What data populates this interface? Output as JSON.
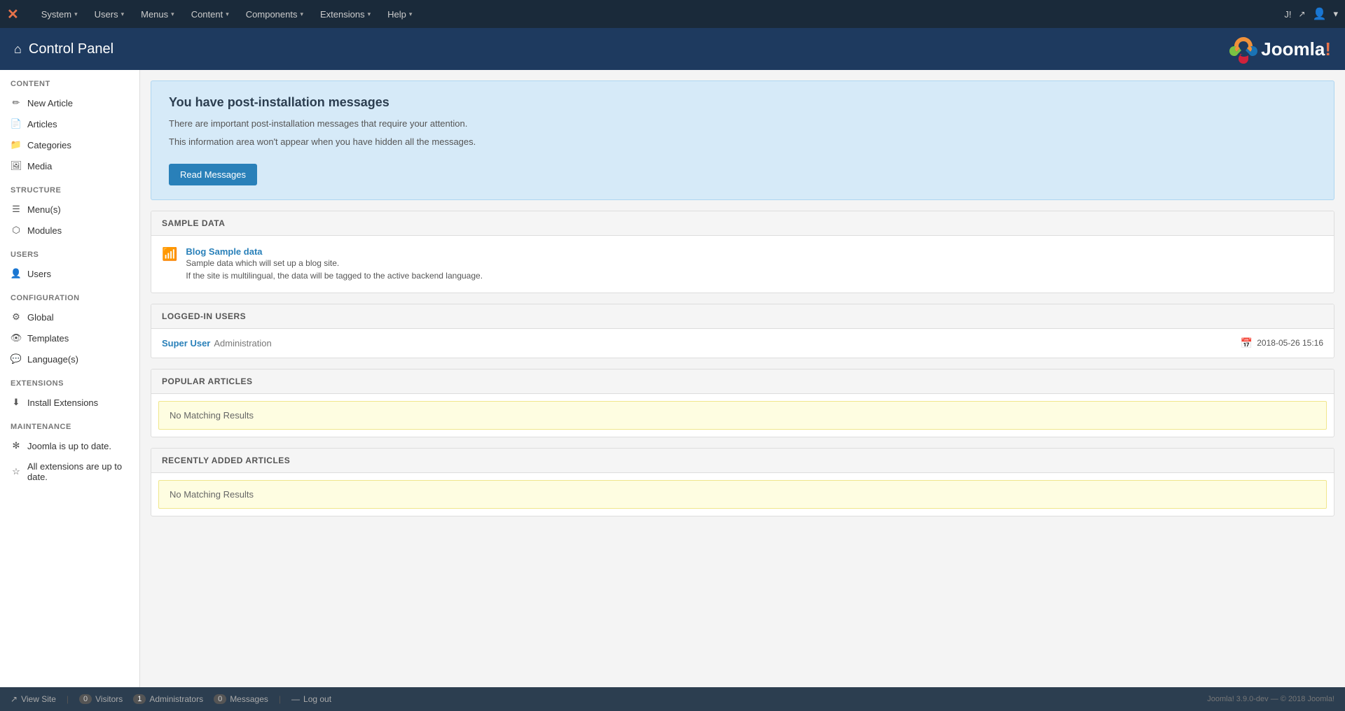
{
  "topbar": {
    "brand": "Joomla!",
    "nav_items": [
      {
        "label": "System",
        "has_arrow": true
      },
      {
        "label": "Users",
        "has_arrow": true
      },
      {
        "label": "Menus",
        "has_arrow": true
      },
      {
        "label": "Content",
        "has_arrow": true
      },
      {
        "label": "Components",
        "has_arrow": true
      },
      {
        "label": "Extensions",
        "has_arrow": true
      },
      {
        "label": "Help",
        "has_arrow": true
      }
    ],
    "right_label": "J!",
    "user_icon": "👤"
  },
  "header": {
    "title": "Control Panel",
    "logo_text": "Joomla",
    "logo_exclaim": "!"
  },
  "sidebar": {
    "sections": [
      {
        "title": "CONTENT",
        "items": [
          {
            "label": "New Article",
            "icon": "pencil"
          },
          {
            "label": "Articles",
            "icon": "file"
          },
          {
            "label": "Categories",
            "icon": "folder"
          },
          {
            "label": "Media",
            "icon": "image"
          }
        ]
      },
      {
        "title": "STRUCTURE",
        "items": [
          {
            "label": "Menu(s)",
            "icon": "list"
          },
          {
            "label": "Modules",
            "icon": "cube"
          }
        ]
      },
      {
        "title": "USERS",
        "items": [
          {
            "label": "Users",
            "icon": "person"
          }
        ]
      },
      {
        "title": "CONFIGURATION",
        "items": [
          {
            "label": "Global",
            "icon": "gear"
          },
          {
            "label": "Templates",
            "icon": "eye"
          },
          {
            "label": "Language(s)",
            "icon": "chat"
          }
        ]
      },
      {
        "title": "EXTENSIONS",
        "items": [
          {
            "label": "Install Extensions",
            "icon": "download"
          }
        ]
      },
      {
        "title": "MAINTENANCE",
        "items": [
          {
            "label": "Joomla is up to date.",
            "icon": "joomla"
          },
          {
            "label": "All extensions are up to date.",
            "icon": "star"
          }
        ]
      }
    ]
  },
  "banner": {
    "title": "You have post-installation messages",
    "line1": "There are important post-installation messages that require your attention.",
    "line2": "This information area won't appear when you have hidden all the messages.",
    "button_label": "Read Messages"
  },
  "sample_data": {
    "section_title": "SAMPLE DATA",
    "items": [
      {
        "link": "Blog Sample data",
        "desc1": "Sample data which will set up a blog site.",
        "desc2": "If the site is multilingual, the data will be tagged to the active backend language."
      }
    ]
  },
  "logged_in_users": {
    "section_title": "LOGGED-IN USERS",
    "users": [
      {
        "name": "Super User",
        "role": "Administration",
        "date": "2018-05-26 15:16"
      }
    ]
  },
  "popular_articles": {
    "section_title": "POPULAR ARTICLES",
    "no_results": "No Matching Results"
  },
  "recently_added": {
    "section_title": "RECENTLY ADDED ARTICLES",
    "no_results": "No Matching Results"
  },
  "footer": {
    "view_site": "View Site",
    "visitors_label": "Visitors",
    "visitors_count": "0",
    "administrators_label": "Administrators",
    "administrators_count": "1",
    "messages_label": "Messages",
    "messages_count": "0",
    "logout": "Log out",
    "version": "Joomla! 3.9.0-dev — © 2018 Joomla!"
  }
}
